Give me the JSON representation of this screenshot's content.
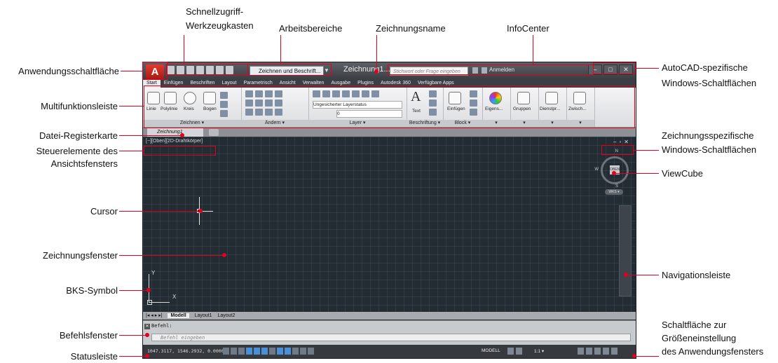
{
  "callouts": {
    "qat": [
      "Schnellzugriff-",
      "Werkzeugkasten"
    ],
    "workspaces": "Arbeitsbereiche",
    "drawing_name": "Zeichnungsname",
    "infocenter": "InfoCenter",
    "app_button": "Anwendungsschaltfläche",
    "autocad_win": [
      "AutoCAD-spezifische",
      "Windows-Schaltflächen"
    ],
    "ribbon": "Multifunktionsleiste",
    "file_tab": "Datei-Registerkarte",
    "drawing_win_btns": [
      "Zeichnungsspezifische",
      "Windows-Schaltflächen"
    ],
    "viewport_controls": [
      "Steuerelemente des",
      "Ansichtsfensters"
    ],
    "viewcube": "ViewCube",
    "cursor": "Cursor",
    "drawing_window": "Zeichnungsfenster",
    "navbar": "Navigationsleiste",
    "ucs": "BKS-Symbol",
    "command_window": "Befehlsfenster",
    "resize": [
      "Schaltfläche zur",
      "Größeneinstellung",
      "des Anwendungsfensters"
    ],
    "statusbar": "Statusleiste"
  },
  "app": {
    "app_button_glyph": "A",
    "workspace": "Zeichnen und Beschrift...",
    "doc_title": "Zeichnung1...",
    "search_placeholder": "Stichwort oder Frage eingeben",
    "sign_in": "Anmelden",
    "ribbon_tabs": [
      "Start",
      "Einfügen",
      "Beschriften",
      "Layout",
      "Parametrisch",
      "Ansicht",
      "Verwalten",
      "Ausgabe",
      "Plugins",
      "Autodesk 360",
      "Verfügbare Apps"
    ],
    "ribbon_panels": {
      "draw": {
        "title": "Zeichnen ▾",
        "tools": [
          "Linie",
          "Polylinie",
          "Kreis",
          "Bogen"
        ]
      },
      "modify": {
        "title": "Ändern ▾"
      },
      "layer": {
        "title": "Layer ▾",
        "state": "Ungesicherter Layerstatus",
        "current": "0"
      },
      "annotation": {
        "title": "Beschriftung ▾",
        "tool": "Text"
      },
      "block": {
        "title": "Block ▾",
        "tool": "Einfügen"
      },
      "properties": {
        "tool": "Eigens..."
      },
      "groups": {
        "tool": "Gruppen"
      },
      "utilities": {
        "tool": "Dienstpr..."
      },
      "clipboard": {
        "tool": "Zwisch..."
      }
    },
    "file_tab": "Zeichnung1",
    "viewport_label": "[−][Oben][2D-Drahtkörper]",
    "viewcube": {
      "face": "OBEN",
      "n": "N",
      "s": "S",
      "w": "W",
      "wcs": "WKS ▾"
    },
    "ucs": {
      "x": "X",
      "y": "Y"
    },
    "layout_tabs": [
      "Modell",
      "Layout1",
      "Layout2"
    ],
    "command_history": "Befehl:",
    "command_placeholder": "Befehl eingeben",
    "coords": "1047.3117, 1546.2932, 0.0000",
    "status_modell": "MODELL",
    "status_scale": "1:1 ▾"
  },
  "colors": {
    "leader": "#e1001e",
    "drawing_bg": "#232b33",
    "app_button": "#c8231a"
  }
}
